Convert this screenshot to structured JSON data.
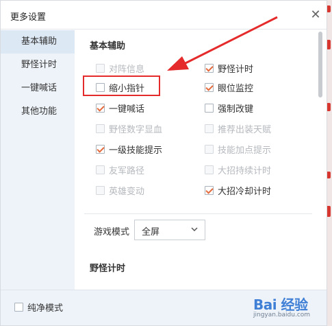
{
  "dialog": {
    "title": "更多设置",
    "close_icon": "close-icon"
  },
  "sidebar": {
    "items": [
      {
        "label": "基本辅助",
        "active": true
      },
      {
        "label": "野怪计时",
        "active": false
      },
      {
        "label": "一键喊话",
        "active": false
      },
      {
        "label": "其他功能",
        "active": false
      }
    ]
  },
  "content": {
    "section1_title": "基本辅助",
    "left_options": [
      {
        "label": "对阵信息",
        "checked": false,
        "disabled": true
      },
      {
        "label": "缩小指针",
        "checked": false,
        "disabled": false
      },
      {
        "label": "一键喊话",
        "checked": true,
        "disabled": false
      },
      {
        "label": "野怪数字显血",
        "checked": false,
        "disabled": true
      },
      {
        "label": "一级技能提示",
        "checked": true,
        "disabled": false
      },
      {
        "label": "友军路径",
        "checked": false,
        "disabled": true
      },
      {
        "label": "英雄变动",
        "checked": false,
        "disabled": true
      }
    ],
    "right_options": [
      {
        "label": "野怪计时",
        "checked": true,
        "disabled": false
      },
      {
        "label": "眼位监控",
        "checked": true,
        "disabled": false
      },
      {
        "label": "强制改键",
        "checked": false,
        "disabled": false
      },
      {
        "label": "推荐出装天赋",
        "checked": false,
        "disabled": true
      },
      {
        "label": "技能加点提示",
        "checked": false,
        "disabled": true
      },
      {
        "label": "大招持续计时",
        "checked": false,
        "disabled": true
      },
      {
        "label": "大招冷却计时",
        "checked": true,
        "disabled": false
      }
    ],
    "game_mode_label": "游戏模式",
    "game_mode_value": "全屏",
    "section2_title": "野怪计时"
  },
  "footer": {
    "pure_mode_label": "纯净模式",
    "pure_mode_checked": false
  },
  "watermark": {
    "main": "Bai 经验",
    "sub": "jingyan.baidu.com"
  },
  "colors": {
    "accent_check": "#e46a3c",
    "highlight_box": "#e42a2a",
    "arrow": "#e42a2a",
    "sidebar_bg": "#eef3f9",
    "sidebar_active": "#dde8f5"
  }
}
